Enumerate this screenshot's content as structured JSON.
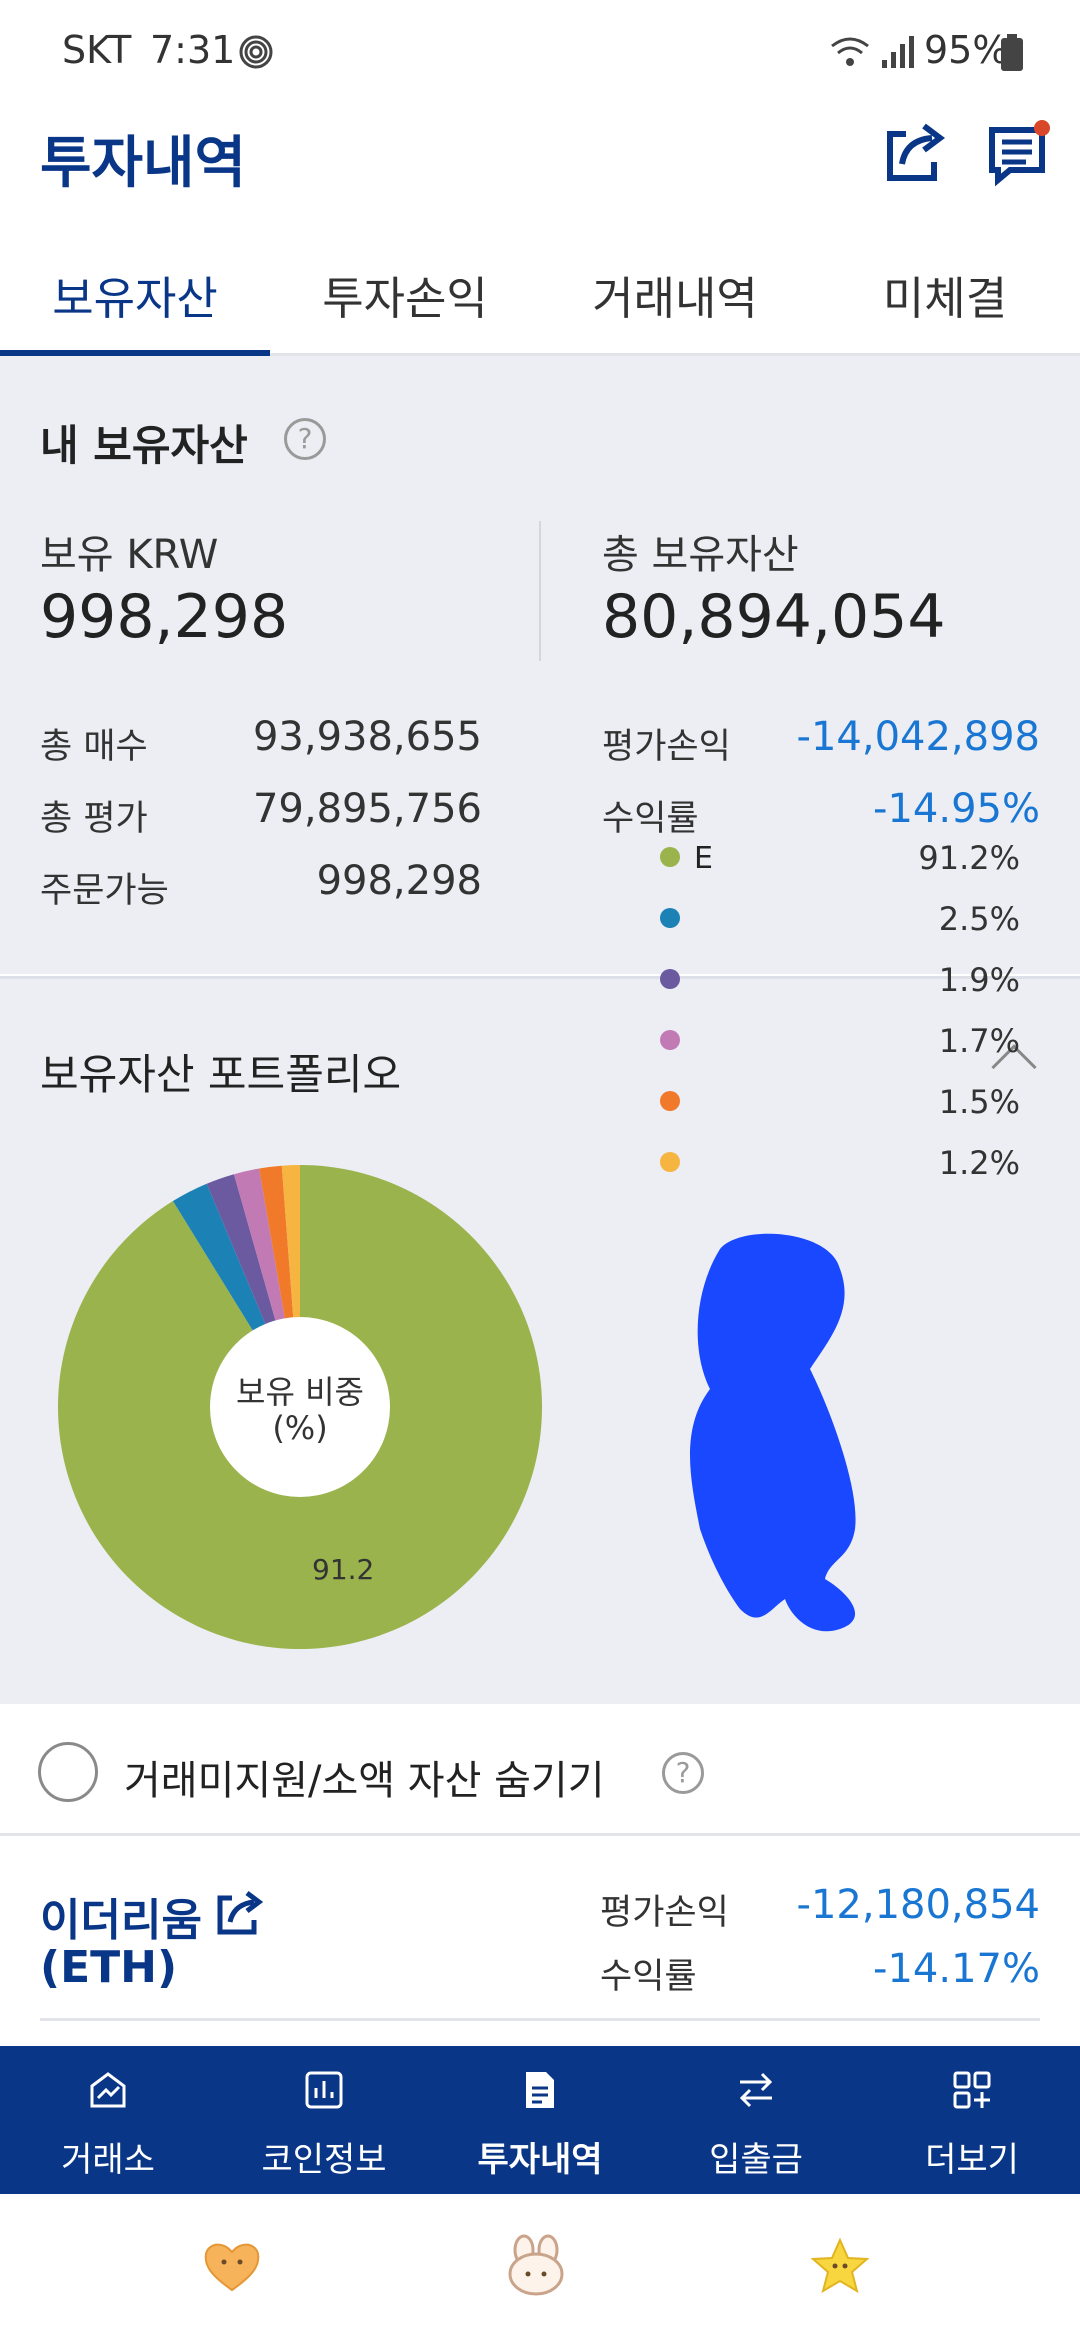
{
  "status_bar": {
    "carrier": "SKT",
    "time": "7:31",
    "battery": "95%"
  },
  "header": {
    "title": "투자내역",
    "icons": [
      "share-icon",
      "notice-icon"
    ]
  },
  "tabs": [
    {
      "label": "보유자산",
      "active": true
    },
    {
      "label": "투자손익",
      "active": false
    },
    {
      "label": "거래내역",
      "active": false
    },
    {
      "label": "미체결",
      "active": false
    }
  ],
  "summary": {
    "section_title": "내 보유자산",
    "help_glyph": "?",
    "krw_label": "보유 KRW",
    "krw_value": "998,298",
    "total_label": "총 보유자산",
    "total_value": "80,894,054",
    "rows_left": [
      {
        "label": "총 매수",
        "value": "93,938,655"
      },
      {
        "label": "총 평가",
        "value": "79,895,756"
      },
      {
        "label": "주문가능",
        "value": "998,298"
      }
    ],
    "rows_right": [
      {
        "label": "평가손익",
        "value": "-14,042,898"
      },
      {
        "label": "수익률",
        "value": "-14.95%"
      }
    ]
  },
  "portfolio": {
    "title": "보유자산 포트폴리오",
    "center_label_line1": "보유 비중",
    "center_label_line2": "(%)",
    "slice_label": "91.2",
    "legend_partial_label": "E",
    "colors": {
      "green": "#9ab34c",
      "teal": "#1c82b5",
      "purple": "#6b5aa0",
      "pink": "#c27ab5",
      "orange": "#f07a2a",
      "yellow": "#f6b441",
      "redaction": "#1a48ff"
    }
  },
  "chart_data": {
    "type": "pie",
    "donut": true,
    "values": [
      91.2,
      2.5,
      1.9,
      1.7,
      1.5,
      1.2
    ],
    "value_labels": [
      "91.2%",
      "2.5%",
      "1.9%",
      "1.7%",
      "1.5%",
      "1.2%"
    ],
    "series_colors": [
      "#9ab34c",
      "#1c82b5",
      "#6b5aa0",
      "#c27ab5",
      "#f07a2a",
      "#f6b441"
    ]
  },
  "hide_option": {
    "label": "거래미지원/소액 자산 숨기기",
    "help_glyph": "?"
  },
  "asset": {
    "name_line1": "이더리움",
    "name_line2": "(ETH)",
    "pnl_label": "평가손익",
    "pnl_value": "-12,180,854",
    "rate_label": "수익률",
    "rate_value": "-14.17%"
  },
  "bottom_nav": [
    {
      "label": "거래소",
      "icon": "chart-line-icon",
      "active": false
    },
    {
      "label": "코인정보",
      "icon": "bar-chart-icon",
      "active": false
    },
    {
      "label": "투자내역",
      "icon": "document-icon",
      "active": true
    },
    {
      "label": "입출금",
      "icon": "transfer-icon",
      "active": false
    },
    {
      "label": "더보기",
      "icon": "grid-plus-icon",
      "active": false
    }
  ]
}
